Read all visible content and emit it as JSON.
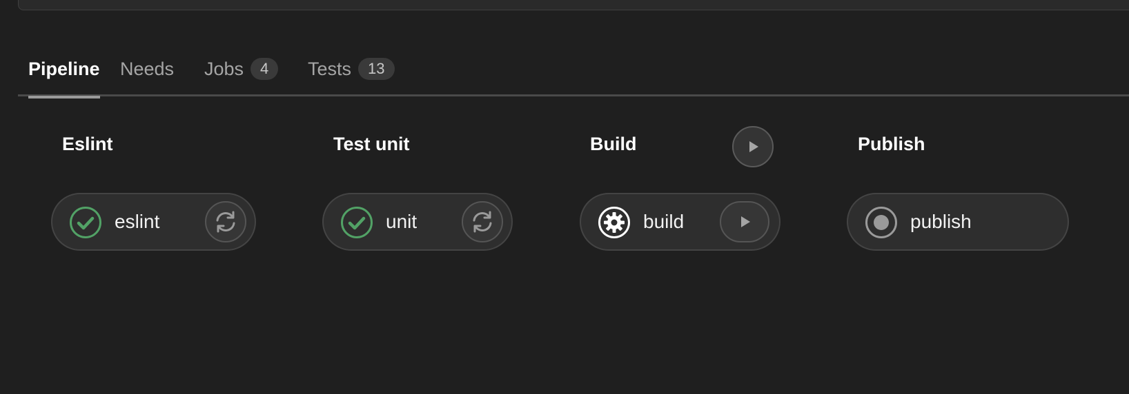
{
  "tabs": [
    {
      "label": "Pipeline",
      "active": true
    },
    {
      "label": "Needs"
    },
    {
      "label": "Jobs",
      "count": "4"
    },
    {
      "label": "Tests",
      "count": "13"
    }
  ],
  "stages": [
    {
      "title": "Eslint",
      "job": {
        "name": "eslint",
        "status": "success",
        "status_icon": "check-circle-icon",
        "action_icon": "retry-icon"
      }
    },
    {
      "title": "Test unit",
      "job": {
        "name": "unit",
        "status": "success",
        "status_icon": "check-circle-icon",
        "action_icon": "retry-icon"
      }
    },
    {
      "title": "Build",
      "stage_action_icon": "play-icon",
      "job": {
        "name": "build",
        "status": "manual",
        "status_icon": "gear-icon",
        "action_icon": "play-icon"
      }
    },
    {
      "title": "Publish",
      "job": {
        "name": "publish",
        "status": "created",
        "status_icon": "status-created-icon"
      }
    }
  ],
  "colors": {
    "background": "#1f1f1f",
    "success": "#52a266",
    "icon_muted": "#9a9a9a"
  }
}
